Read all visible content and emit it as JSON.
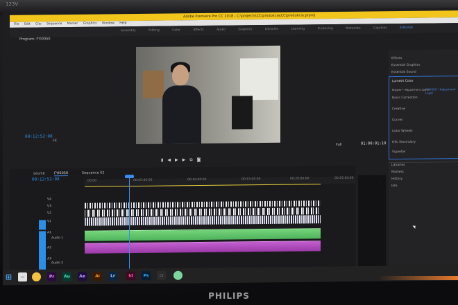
{
  "camera_overlay": "123V",
  "app": {
    "title": "Adobe Premiere Pro CC 2018 - C:\\projects\\CC\\produkcia\\CC\\produkcia.prproj",
    "menu": [
      "File",
      "Edit",
      "Clip",
      "Sequence",
      "Marker",
      "Graphics",
      "Window",
      "Help"
    ],
    "workspaces": [
      "Assembly",
      "Editing",
      "Color",
      "Effects",
      "Audio",
      "Graphics",
      "Libraries",
      "Learning",
      "Producing",
      "Metadata",
      "Captions",
      "Editorial"
    ],
    "active_workspace": "Editorial"
  },
  "program_monitor": {
    "label": "Program: FYI0050",
    "timecode": "00:12:52:08",
    "fit": "Fit",
    "quality": "Full",
    "duration": "01:00:01:10"
  },
  "right_panel": {
    "items": [
      "Effects",
      "Essential Graphics",
      "Essential Sound"
    ],
    "lumetri_title": "Lumetri Color",
    "lumetri_source": "Master * Adjustment Layer",
    "lumetri_target": "FYI0050 * Adjustment Layer",
    "lumetri_sections": [
      "Basic Correction",
      "Creative",
      "Curves",
      "Color Wheels",
      "HSL Secondary",
      "Vignette"
    ],
    "lower_items": [
      "Libraries",
      "Markers",
      "History",
      "Info"
    ]
  },
  "timeline": {
    "tabs": [
      "source",
      "FYI0050",
      "Sequence 02"
    ],
    "active_tab": "FYI0050",
    "timecode": "00:12:52:08",
    "ruler": [
      "00:00",
      "00:05:00:00",
      "00:10:00:00",
      "00:15:00:00",
      "00:20:00:00",
      "00:25:00:00"
    ],
    "tracks": [
      "V4",
      "V3",
      "V2",
      "V1",
      "A1",
      "A2",
      "A3"
    ],
    "audio_names": [
      "Audio 1",
      "Audio 2"
    ]
  },
  "taskbar": {
    "apps": [
      "Pr",
      "Au",
      "Ae",
      "Ai",
      "Lr",
      "Id",
      "Ps"
    ]
  },
  "monitor_brand": "PHILIPS"
}
